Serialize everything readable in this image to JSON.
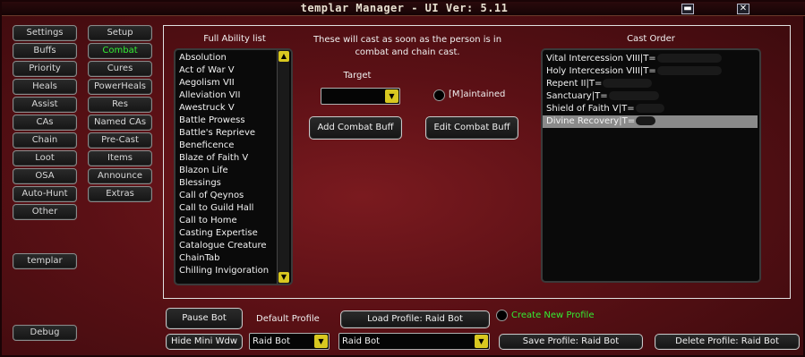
{
  "window": {
    "title": "templar Manager  - UI Ver: 5.11",
    "minimize_glyph": "▬",
    "close_glyph": "✕"
  },
  "nav_left": [
    "Settings",
    "Buffs",
    "Priority",
    "Heals",
    "Assist",
    "CAs",
    "Chain",
    "Loot",
    "OSA",
    "Auto-Hunt",
    "Other"
  ],
  "nav_right": [
    "Setup",
    "Combat",
    "Cures",
    "PowerHeals",
    "Res",
    "Named CAs",
    "Pre-Cast",
    "Items",
    "Announce",
    "Extras"
  ],
  "nav_selected": "Combat",
  "profile_tag": "templar",
  "debug_label": "Debug",
  "ability_list": {
    "title": "Full Ability list",
    "items": [
      "Absolution",
      "Act of War V",
      "Aegolism VII",
      "Alleviation VII",
      "Awestruck V",
      "Battle Prowess",
      "Battle's Reprieve",
      "Beneficence",
      "Blaze of Faith V",
      "Blazon Life",
      "Blessings",
      "Call of Qeynos",
      "Call to Guild Hall",
      "Call to Home",
      "Casting Expertise",
      "Catalogue Creature",
      "ChainTab",
      "Chilling Invigoration"
    ],
    "scroll_up": "▲",
    "scroll_down": "▼"
  },
  "info_text_line1": "These will cast as soon as the person is in",
  "info_text_line2": "combat and chain cast.",
  "target": {
    "label": "Target",
    "value": "",
    "dd_glyph": "▼"
  },
  "maintained_label": "[M]aintained",
  "add_buff_label": "Add Combat Buff",
  "edit_buff_label": "Edit Combat Buff",
  "cast_order": {
    "title": "Cast Order",
    "items": [
      {
        "text": "Vital Intercession VIII|T=",
        "highlighted": false
      },
      {
        "text": "Holy Intercession VIII|T=",
        "highlighted": false
      },
      {
        "text": "Repent II|T=",
        "highlighted": false
      },
      {
        "text": "Sanctuary|T=",
        "highlighted": false
      },
      {
        "text": "Shield of Faith V|T=",
        "highlighted": false
      },
      {
        "text": "Divine Recovery|T=",
        "highlighted": true
      }
    ]
  },
  "bottom": {
    "pause_bot": "Pause Bot",
    "hide_mini": "Hide Mini Wdw",
    "default_profile_label": "Default Profile",
    "default_profile_value": "Raid Bot",
    "load_profile": "Load Profile: Raid Bot",
    "profile_value": "Raid Bot",
    "create_new_profile": "Create New Profile",
    "save_profile": "Save Profile: Raid Bot",
    "delete_profile": "Delete Profile: Raid Bot",
    "dd_glyph": "▼"
  },
  "colors": {
    "selected_text": "#33ee33",
    "accent_yellow": "#d8c820",
    "background_red": "#5a1015"
  }
}
